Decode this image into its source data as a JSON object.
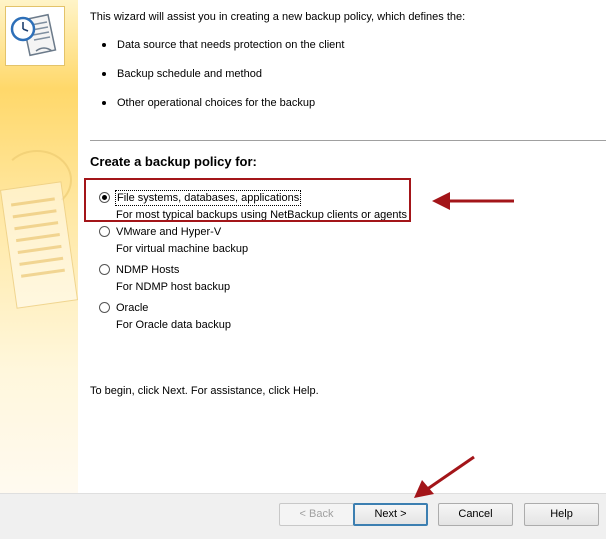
{
  "intro": {
    "text": "This wizard will assist you in creating a new backup policy, which defines the:",
    "bullets": [
      "Data source that needs protection on the client",
      "Backup schedule and method",
      "Other operational choices for the backup"
    ]
  },
  "section_title": "Create a backup policy for:",
  "options": [
    {
      "label": "File systems, databases, applications",
      "description": "For most typical backups using NetBackup clients or agents",
      "selected": true
    },
    {
      "label": "VMware and Hyper-V",
      "description": "For virtual machine backup",
      "selected": false
    },
    {
      "label": "NDMP Hosts",
      "description": "For NDMP host backup",
      "selected": false
    },
    {
      "label": "Oracle",
      "description": "For Oracle data backup",
      "selected": false
    }
  ],
  "begin_text": "To begin, click Next. For assistance, click Help.",
  "buttons": {
    "back": "< Back",
    "next": "Next >",
    "cancel": "Cancel",
    "help": "Help"
  },
  "colors": {
    "annotation_red": "#a31519",
    "banner_yellow": "#ffd86a"
  },
  "icons": {
    "wizard": "policy-document-clock-icon"
  }
}
